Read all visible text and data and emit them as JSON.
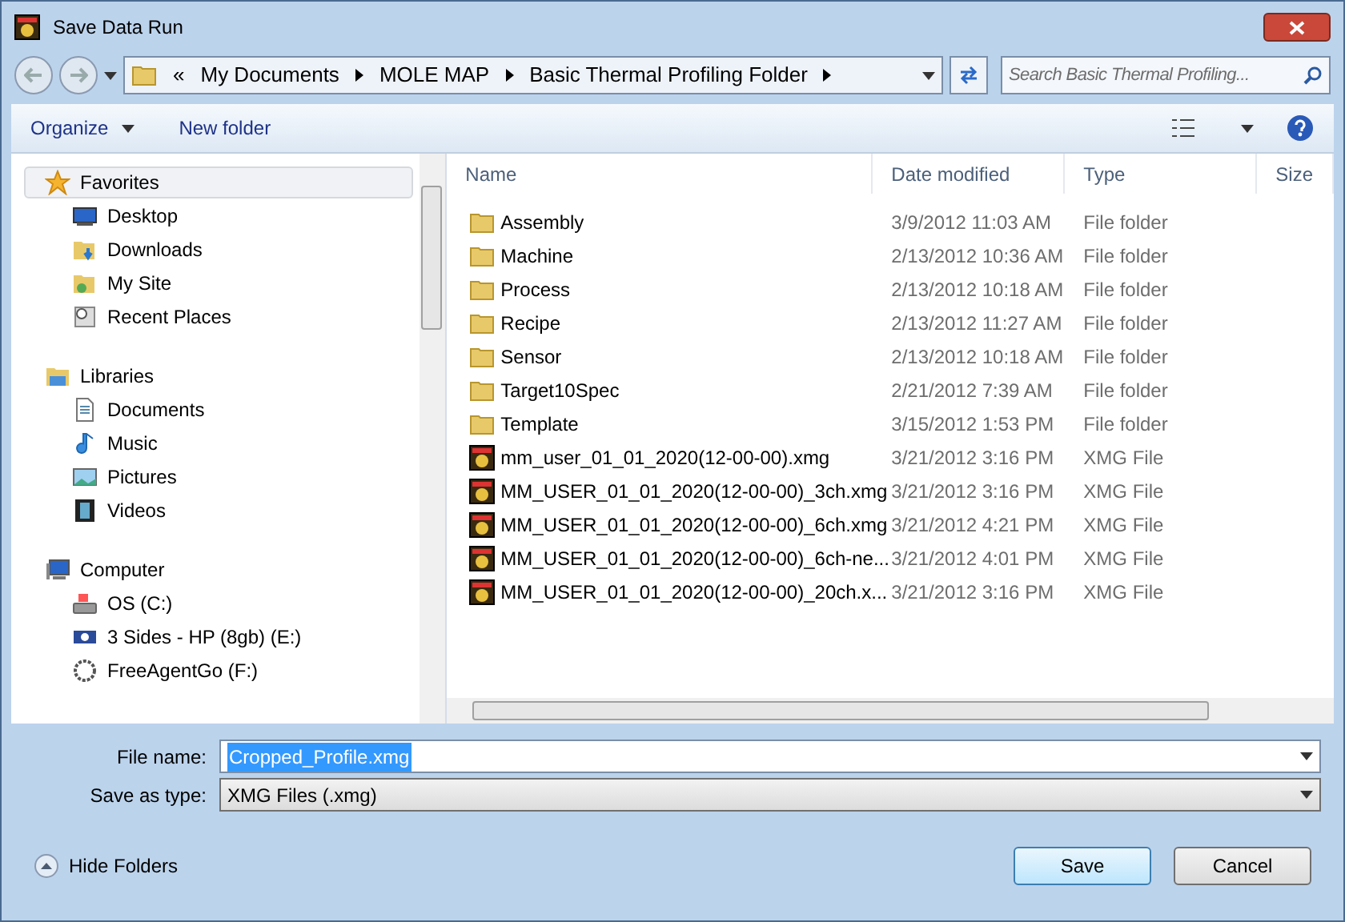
{
  "window": {
    "title": "Save Data Run"
  },
  "address": {
    "overflow": "«",
    "crumbs": [
      "My Documents",
      "MOLE MAP",
      "Basic Thermal Profiling Folder"
    ]
  },
  "search": {
    "placeholder": "Search Basic Thermal Profiling..."
  },
  "toolbar": {
    "organize": "Organize",
    "new_folder": "New folder"
  },
  "sidebar": {
    "groups": [
      {
        "label": "Favorites",
        "kind": "favorites",
        "selected": true,
        "children": [
          {
            "label": "Desktop",
            "kind": "desktop"
          },
          {
            "label": "Downloads",
            "kind": "downloads"
          },
          {
            "label": "My Site",
            "kind": "site"
          },
          {
            "label": "Recent Places",
            "kind": "recent"
          }
        ]
      },
      {
        "label": "Libraries",
        "kind": "libraries",
        "selected": false,
        "children": [
          {
            "label": "Documents",
            "kind": "documents"
          },
          {
            "label": "Music",
            "kind": "music"
          },
          {
            "label": "Pictures",
            "kind": "pictures"
          },
          {
            "label": "Videos",
            "kind": "videos"
          }
        ]
      },
      {
        "label": "Computer",
        "kind": "computer",
        "selected": false,
        "children": [
          {
            "label": "OS (C:)",
            "kind": "drive"
          },
          {
            "label": "3 Sides - HP (8gb) (E:)",
            "kind": "usb"
          },
          {
            "label": "FreeAgentGo (F:)",
            "kind": "disc"
          }
        ]
      }
    ]
  },
  "table": {
    "columns": [
      "Name",
      "Date modified",
      "Type",
      "Size"
    ],
    "rows": [
      {
        "kind": "folder",
        "name": "Assembly",
        "date": "3/9/2012 11:03 AM",
        "type": "File folder"
      },
      {
        "kind": "folder",
        "name": "Machine",
        "date": "2/13/2012 10:36 AM",
        "type": "File folder"
      },
      {
        "kind": "folder",
        "name": "Process",
        "date": "2/13/2012 10:18 AM",
        "type": "File folder"
      },
      {
        "kind": "folder",
        "name": "Recipe",
        "date": "2/13/2012 11:27 AM",
        "type": "File folder"
      },
      {
        "kind": "folder",
        "name": "Sensor",
        "date": "2/13/2012 10:18 AM",
        "type": "File folder"
      },
      {
        "kind": "folder",
        "name": "Target10Spec",
        "date": "2/21/2012 7:39 AM",
        "type": "File folder"
      },
      {
        "kind": "folder",
        "name": "Template",
        "date": "3/15/2012 1:53 PM",
        "type": "File folder"
      },
      {
        "kind": "file",
        "name": "mm_user_01_01_2020(12-00-00).xmg",
        "date": "3/21/2012 3:16 PM",
        "type": "XMG File"
      },
      {
        "kind": "file",
        "name": "MM_USER_01_01_2020(12-00-00)_3ch.xmg",
        "date": "3/21/2012 3:16 PM",
        "type": "XMG File"
      },
      {
        "kind": "file",
        "name": "MM_USER_01_01_2020(12-00-00)_6ch.xmg",
        "date": "3/21/2012 4:21 PM",
        "type": "XMG File"
      },
      {
        "kind": "file",
        "name": "MM_USER_01_01_2020(12-00-00)_6ch-ne...",
        "date": "3/21/2012 4:01 PM",
        "type": "XMG File"
      },
      {
        "kind": "file",
        "name": "MM_USER_01_01_2020(12-00-00)_20ch.x...",
        "date": "3/21/2012 3:16 PM",
        "type": "XMG File"
      }
    ]
  },
  "file_name": {
    "label": "File name:",
    "value": "Cropped_Profile.xmg"
  },
  "save_as_type": {
    "label": "Save as type:",
    "value": "XMG Files (.xmg)"
  },
  "hide_folders": "Hide Folders",
  "buttons": [
    "Save",
    "Cancel"
  ]
}
